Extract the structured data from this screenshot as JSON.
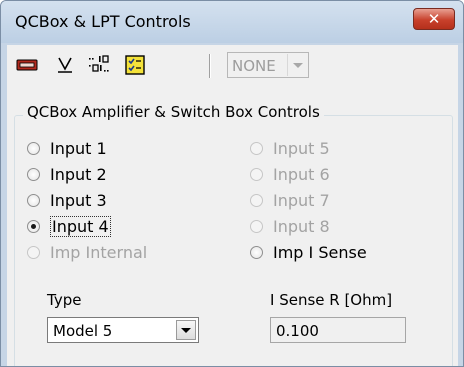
{
  "window": {
    "title": "QCBox & LPT Controls",
    "close_glyph": "✕"
  },
  "toolbar": {
    "icons": [
      "lpt-port-icon",
      "voltage-icon",
      "binary-counter-icon",
      "checklist-icon"
    ],
    "dropdown_value": "NONE"
  },
  "group": {
    "title": "QCBox Amplifier & Switch Box Controls",
    "left_radios": [
      {
        "label": "Input 1",
        "checked": false,
        "enabled": true
      },
      {
        "label": "Input 2",
        "checked": false,
        "enabled": true
      },
      {
        "label": "Input 3",
        "checked": false,
        "enabled": true
      },
      {
        "label": "Input 4",
        "checked": true,
        "enabled": true
      },
      {
        "label": "Imp Internal",
        "checked": false,
        "enabled": false
      }
    ],
    "right_radios": [
      {
        "label": "Input 5",
        "checked": false,
        "enabled": false
      },
      {
        "label": "Input 6",
        "checked": false,
        "enabled": false
      },
      {
        "label": "Input 7",
        "checked": false,
        "enabled": false
      },
      {
        "label": "Input 8",
        "checked": false,
        "enabled": false
      },
      {
        "label": "Imp I Sense",
        "checked": false,
        "enabled": true
      }
    ],
    "type_label": "Type",
    "type_value": "Model 5",
    "isense_label": "I Sense R [Ohm]",
    "isense_value": "0.100"
  },
  "colors": {
    "titlebar": "#c6d5e6",
    "close": "#c8412c",
    "face": "#f0f0f0",
    "disabled_text": "#a3a3a3"
  }
}
